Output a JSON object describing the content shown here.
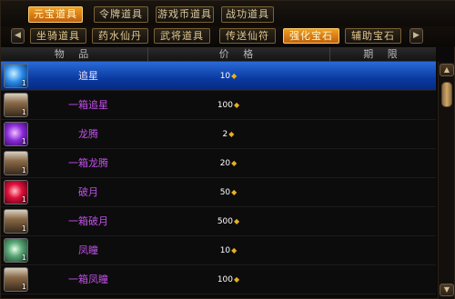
{
  "top_tabs": [
    {
      "label": "元宝道具",
      "active": true
    },
    {
      "label": "令牌道具",
      "active": false
    },
    {
      "label": "游戏币道具",
      "active": false
    },
    {
      "label": "战功道具",
      "active": false
    }
  ],
  "sub_tabs": [
    {
      "label": "坐骑道具",
      "active": false
    },
    {
      "label": "药水仙丹",
      "active": false
    },
    {
      "label": "武将道具",
      "active": false
    },
    {
      "label": "传送仙符",
      "active": false
    },
    {
      "label": "强化宝石",
      "active": true
    },
    {
      "label": "辅助宝石",
      "active": false
    }
  ],
  "icons": {
    "prev": "◀",
    "next": "▶",
    "scroll_up": "▲",
    "scroll_down": "▼",
    "coin": "ingot-icon"
  },
  "columns": {
    "item": "物 品",
    "price": "价 格",
    "duration": "期 限"
  },
  "items": [
    {
      "name": "追星",
      "price": "10",
      "qty": "1",
      "icon": "blue-gem",
      "selected": true
    },
    {
      "name": "一箱追星",
      "price": "100",
      "qty": "1",
      "icon": "chest",
      "selected": false
    },
    {
      "name": "龙腾",
      "price": "2",
      "qty": "1",
      "icon": "purple-gem",
      "selected": false
    },
    {
      "name": "一箱龙腾",
      "price": "20",
      "qty": "1",
      "icon": "chest",
      "selected": false
    },
    {
      "name": "破月",
      "price": "50",
      "qty": "1",
      "icon": "red-gem",
      "selected": false
    },
    {
      "name": "一箱破月",
      "price": "500",
      "qty": "1",
      "icon": "chest",
      "selected": false
    },
    {
      "name": "凤瞳",
      "price": "10",
      "qty": "1",
      "icon": "green-gem",
      "selected": false
    },
    {
      "name": "一箱凤瞳",
      "price": "100",
      "qty": "1",
      "icon": "chest",
      "selected": false
    }
  ],
  "colors": {
    "item_name": "#c050e8",
    "active_tab": "#f0a020",
    "selected_row": "#0a3aa0"
  }
}
